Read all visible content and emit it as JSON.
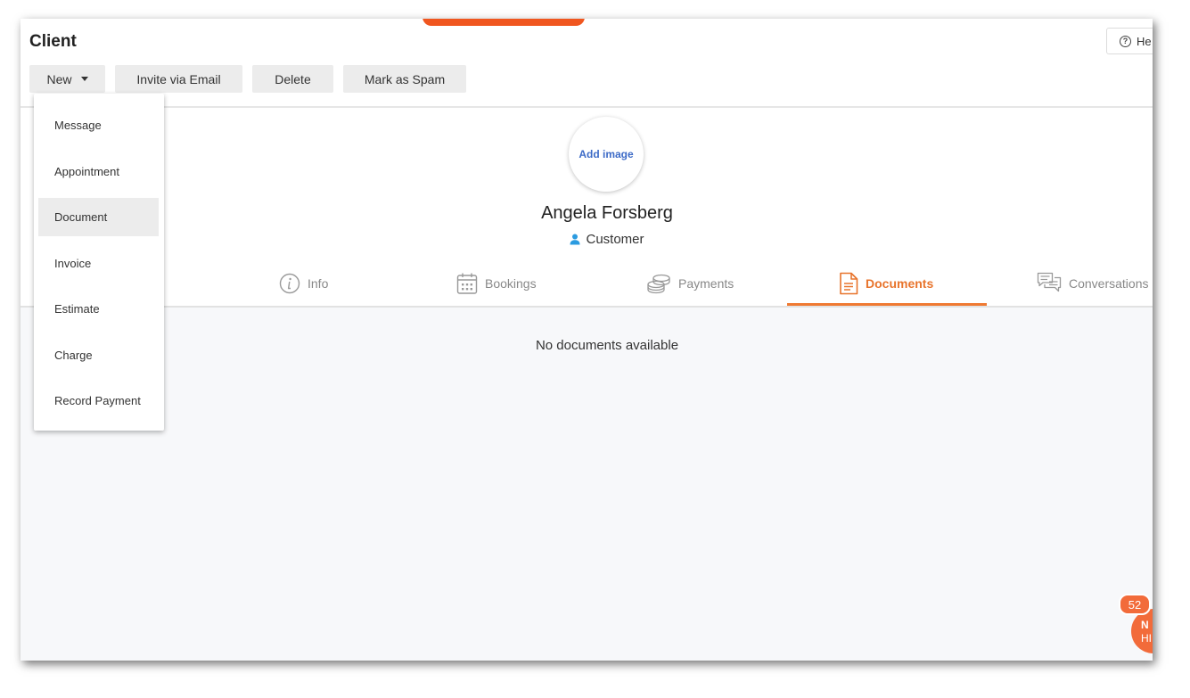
{
  "page": {
    "title": "Client"
  },
  "help": {
    "label": "He"
  },
  "toolbar": {
    "new_label": "New",
    "invite_label": "Invite via Email",
    "delete_label": "Delete",
    "spam_label": "Mark as Spam"
  },
  "new_menu": {
    "items": [
      {
        "label": "Message"
      },
      {
        "label": "Appointment"
      },
      {
        "label": "Document",
        "active": true
      },
      {
        "label": "Invoice"
      },
      {
        "label": "Estimate"
      },
      {
        "label": "Charge"
      },
      {
        "label": "Record Payment"
      }
    ]
  },
  "profile": {
    "avatar_label": "Add image",
    "name": "Angela Forsberg",
    "type": "Customer",
    "type_icon_color": "#2b9be0"
  },
  "tabs": [
    {
      "label": "Info",
      "icon": "info-icon"
    },
    {
      "label": "Bookings",
      "icon": "calendar-icon"
    },
    {
      "label": "Payments",
      "icon": "coins-icon"
    },
    {
      "label": "Documents",
      "icon": "document-icon",
      "active": true
    },
    {
      "label": "Conversations",
      "icon": "chat-bubbles-icon"
    }
  ],
  "documents": {
    "empty_message": "No documents available"
  },
  "chat": {
    "badge_count": "52",
    "line1": "N",
    "line2": "HI"
  },
  "colors": {
    "accent": "#ef7a32",
    "banner": "#f0561f",
    "link": "#3d6bc7"
  }
}
